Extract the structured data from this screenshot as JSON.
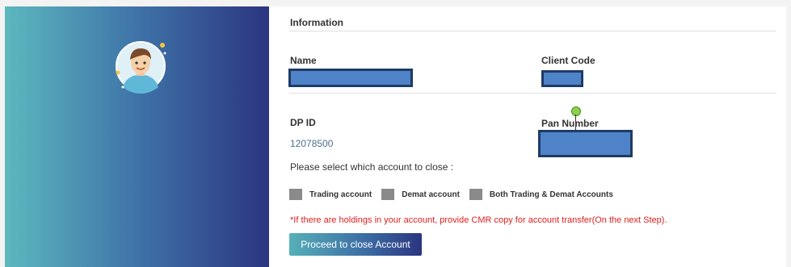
{
  "info_title": "Information",
  "fields": {
    "name_label": "Name",
    "client_code_label": "Client Code",
    "dp_id_label": "DP ID",
    "dp_id_value": "12078500",
    "pan_label": "Pan Number"
  },
  "prompt": "Please select which account to close :",
  "options": [
    "Trading account",
    "Demat account",
    "Both Trading & Demat Accounts"
  ],
  "note": "*If there are holdings in your account, provide CMR copy for account transfer(On the next Step).",
  "button_label": "Proceed to close Account",
  "colors": {
    "accent_teal": "#5cb8bf",
    "accent_navy": "#2b3580",
    "warning_red": "#e0201e",
    "redaction_blue": "#4f83c7"
  }
}
